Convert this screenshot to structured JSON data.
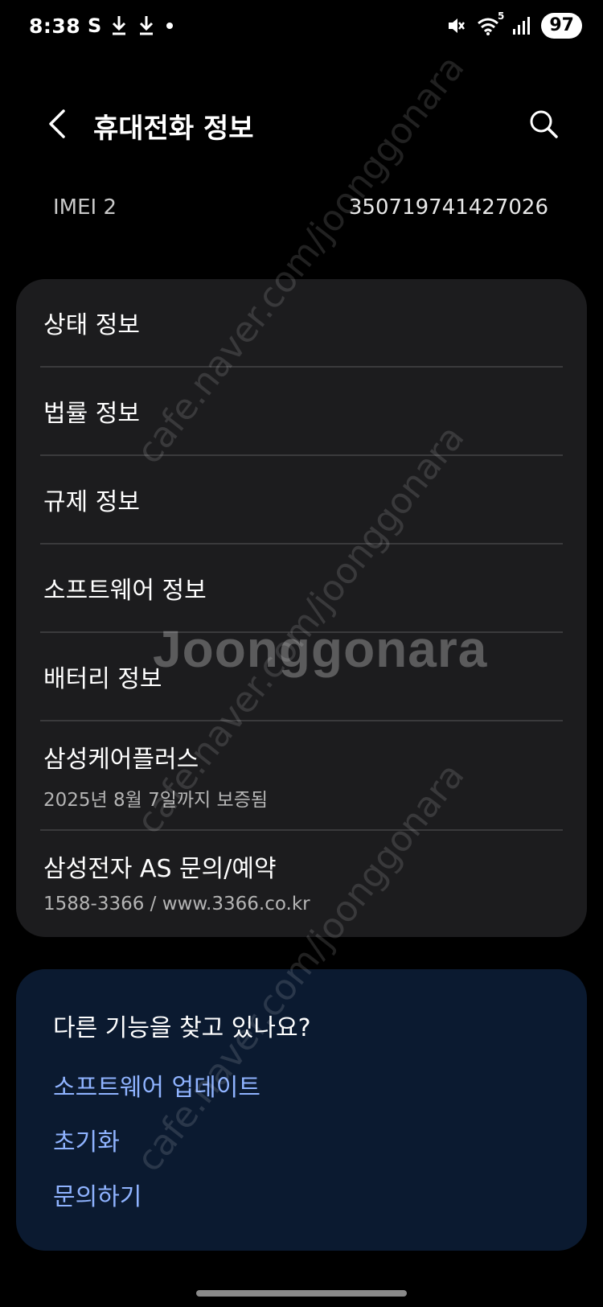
{
  "status_bar": {
    "time": "8:38",
    "left_icons": [
      "s-pay-icon",
      "download-icon",
      "download-icon",
      "dot-icon"
    ],
    "right_icons": [
      "mute-icon",
      "wifi-icon",
      "signal-icon"
    ],
    "wifi_badge": "5",
    "battery": "97"
  },
  "header": {
    "title": "휴대전화 정보"
  },
  "imei": {
    "label": "IMEI 2",
    "value": "350719741427026"
  },
  "menu": {
    "items": [
      {
        "label": "상태 정보"
      },
      {
        "label": "법률 정보"
      },
      {
        "label": "규제 정보"
      },
      {
        "label": "소프트웨어 정보"
      },
      {
        "label": "배터리 정보"
      },
      {
        "label": "삼성케어플러스",
        "sub": "2025년 8월 7일까지 보증됨"
      },
      {
        "label": "삼성전자 AS 문의/예약",
        "sub": "1588-3366 / www.3366.co.kr"
      }
    ]
  },
  "suggest": {
    "title": "다른 기능을 찾고 있나요?",
    "links": [
      "소프트웨어 업데이트",
      "초기화",
      "문의하기"
    ]
  },
  "watermark": {
    "brand": "Joonggonara",
    "url": "cafe.naver.com/joonggonara"
  },
  "colors": {
    "background": "#000000",
    "card": "#1c1c1e",
    "suggest_card": "#0b1a30",
    "link": "#8fb3ff"
  }
}
